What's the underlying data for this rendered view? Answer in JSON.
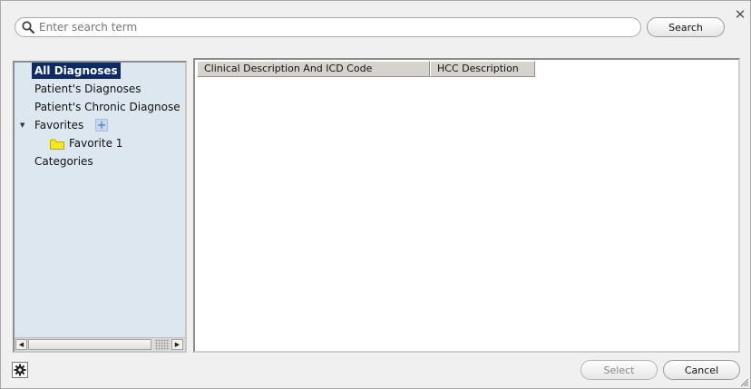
{
  "search": {
    "placeholder": "Enter search term",
    "value": "",
    "button_label": "Search"
  },
  "tree": {
    "items": [
      {
        "label": "All Diagnoses",
        "selected": true
      },
      {
        "label": "Patient's Diagnoses",
        "selected": false
      },
      {
        "label": "Patient's Chronic Diagnose",
        "selected": false
      },
      {
        "label": "Favorites",
        "selected": false,
        "expanded": true
      },
      {
        "label": "Favorite 1",
        "selected": false
      },
      {
        "label": "Categories",
        "selected": false
      }
    ]
  },
  "grid": {
    "columns": [
      "Clinical Description And ICD Code",
      "HCC Description"
    ],
    "rows": []
  },
  "footer": {
    "select_label": "Select",
    "cancel_label": "Cancel",
    "select_enabled": false
  },
  "icons": {
    "close": "close-icon",
    "search": "search-icon",
    "settings": "gear-icon",
    "folder": "folder-icon",
    "add": "plus-icon"
  },
  "colors": {
    "selected_background": "#0c2a63",
    "tree_background": "#dde7f0",
    "dialog_background": "#f0f0f0",
    "folder": "#f7e81e"
  }
}
